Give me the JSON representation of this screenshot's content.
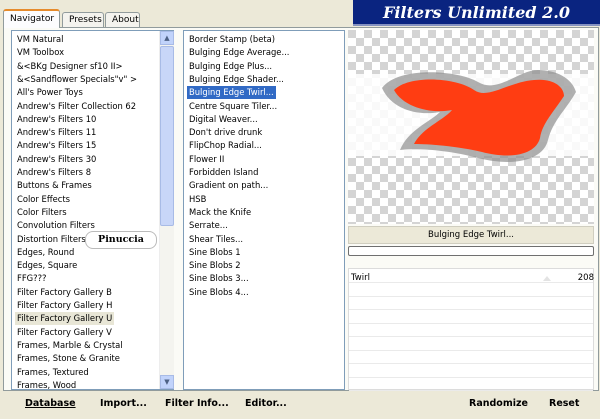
{
  "tabs": [
    "Navigator",
    "Presets",
    "About"
  ],
  "banner_title": "Filters Unlimited 2.0",
  "categories": [
    "VM Natural",
    "VM Toolbox",
    "&<BKg Designer sf10 II>",
    "&<Sandflower Specials\"v\" >",
    "All's Power Toys",
    "Andrew's Filter Collection 62",
    "Andrew's Filters 10",
    "Andrew's Filters 11",
    "Andrew's Filters 15",
    "Andrew's Filters 30",
    "Andrew's Filters 8",
    "Buttons & Frames",
    "Color Effects",
    "Color Filters",
    "Convolution Filters",
    "Distortion Filters",
    "Edges, Round",
    "Edges, Square",
    "FFG???",
    "Filter Factory Gallery B",
    "Filter Factory Gallery H",
    "Filter Factory Gallery U",
    "Filter Factory Gallery V",
    "Frames, Marble & Crystal",
    "Frames, Stone & Granite",
    "Frames, Textured",
    "Frames, Wood"
  ],
  "highlighted_category": "Filter Factory Gallery U",
  "filters": [
    "Border Stamp (beta)",
    "Bulging Edge Average...",
    "Bulging Edge Plus...",
    "Bulging Edge Shader...",
    "Bulging Edge Twirl...",
    "Centre Square Tiler...",
    "Digital Weaver...",
    "Don't drive drunk",
    "FlipChop Radial...",
    "Flower II",
    "Forbidden Island",
    "Gradient on path...",
    "HSB",
    "Mack the Knife",
    "Serrate...",
    "Shear Tiles...",
    "Sine Blobs 1",
    "Sine Blobs 2",
    "Sine Blobs 3...",
    "Sine Blobs 4..."
  ],
  "selected_filter": "Bulging Edge Twirl...",
  "preview_label": "Bulging Edge Twirl...",
  "param": {
    "name": "Twirl",
    "value": "208"
  },
  "signature": "Pinuccia",
  "buttons": {
    "database": "Database",
    "import": "Import...",
    "filter_info": "Filter Info...",
    "editor": "Editor...",
    "randomize": "Randomize",
    "reset": "Reset"
  },
  "colors": {
    "accent": "#316ac5",
    "banner": "#0a2480",
    "preview_shape": "#ff3d12"
  }
}
